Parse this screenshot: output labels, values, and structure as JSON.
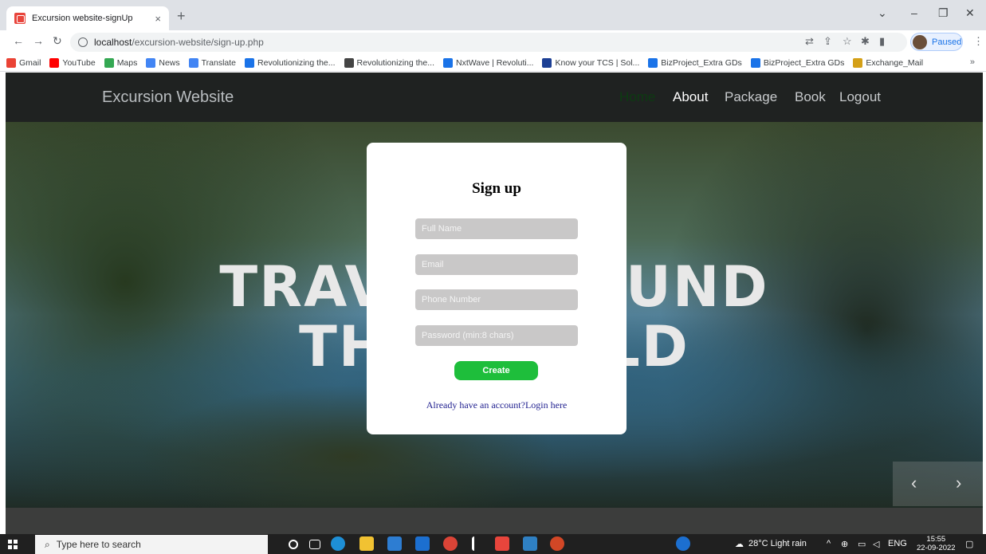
{
  "browser": {
    "tab_title": "Excursion website-signUp",
    "tab_close": "×",
    "new_tab": "+",
    "url_host": "localhost",
    "url_path": "/excursion-website/sign-up.php",
    "profile_status": "Paused",
    "bookmarks": [
      {
        "label": "Gmail",
        "color": "#ea4335"
      },
      {
        "label": "YouTube",
        "color": "#ff0000"
      },
      {
        "label": "Maps",
        "color": "#34a853"
      },
      {
        "label": "News",
        "color": "#4285f4"
      },
      {
        "label": "Translate",
        "color": "#4285f4"
      },
      {
        "label": "Revolutionizing the...",
        "color": "#1a73e8"
      },
      {
        "label": "Revolutionizing the...",
        "color": "#444444"
      },
      {
        "label": "NxtWave | Revoluti...",
        "color": "#1a73e8"
      },
      {
        "label": "Know your TCS | Sol...",
        "color": "#1c3f94"
      },
      {
        "label": "BizProject_Extra GDs",
        "color": "#1a73e8"
      },
      {
        "label": "BizProject_Extra GDs",
        "color": "#1a73e8"
      },
      {
        "label": "Exchange_Mail",
        "color": "#d4a017"
      }
    ],
    "bookmarks_more": "»"
  },
  "site": {
    "brand": "Excursion Website",
    "menu": [
      "Home",
      "About",
      "Package",
      "Book",
      "Logout"
    ],
    "headline_line1": "TRAVEL AROUND",
    "headline_line2": "THE WORLD",
    "prev_arrow": "‹",
    "next_arrow": "›"
  },
  "signup": {
    "title": "Sign up",
    "full_name_placeholder": "Full Name",
    "email_placeholder": "Email",
    "phone_placeholder": "Phone Number",
    "password_placeholder": "Password (min:8 chars)",
    "create_label": "Create",
    "login_link": "Already have an account?Login here"
  },
  "taskbar": {
    "search_placeholder": "Type here to search",
    "weather": "28°C  Light rain",
    "language": "ENG",
    "time": "15:55",
    "date": "22-09-2022"
  }
}
